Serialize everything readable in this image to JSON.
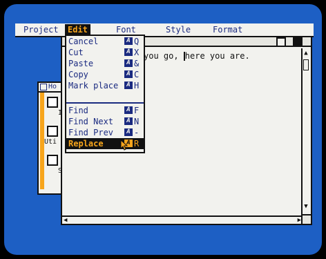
{
  "menubar": {
    "items": [
      "Project",
      "Edit",
      "Font",
      "Style",
      "Format"
    ],
    "active": "Edit"
  },
  "edit_menu": {
    "items": [
      {
        "label": "Cancel",
        "key": "Q"
      },
      {
        "label": "Cut",
        "key": "X"
      },
      {
        "label": "Paste",
        "key": "&"
      },
      {
        "label": "Copy",
        "key": "C"
      },
      {
        "label": "Mark place",
        "key": "H"
      },
      {
        "label": "Find",
        "key": "F"
      },
      {
        "label": "Find Next",
        "key": "N"
      },
      {
        "label": "Find Prev",
        "key": "-"
      },
      {
        "label": "Replace",
        "key": "R"
      }
    ],
    "highlighted": "Replace",
    "amiga_glyph": "A"
  },
  "editor": {
    "text_before_cursor": "you go, ",
    "text_after_cursor": "here you are."
  },
  "back_window": {
    "title": "Ho",
    "labels": [
      "I",
      "Uti",
      "S"
    ]
  },
  "colors": {
    "desktop": "#1d5fc4",
    "window": "#f2f2ee",
    "text": "#1a2a80",
    "highlight": "#f7a51c"
  }
}
